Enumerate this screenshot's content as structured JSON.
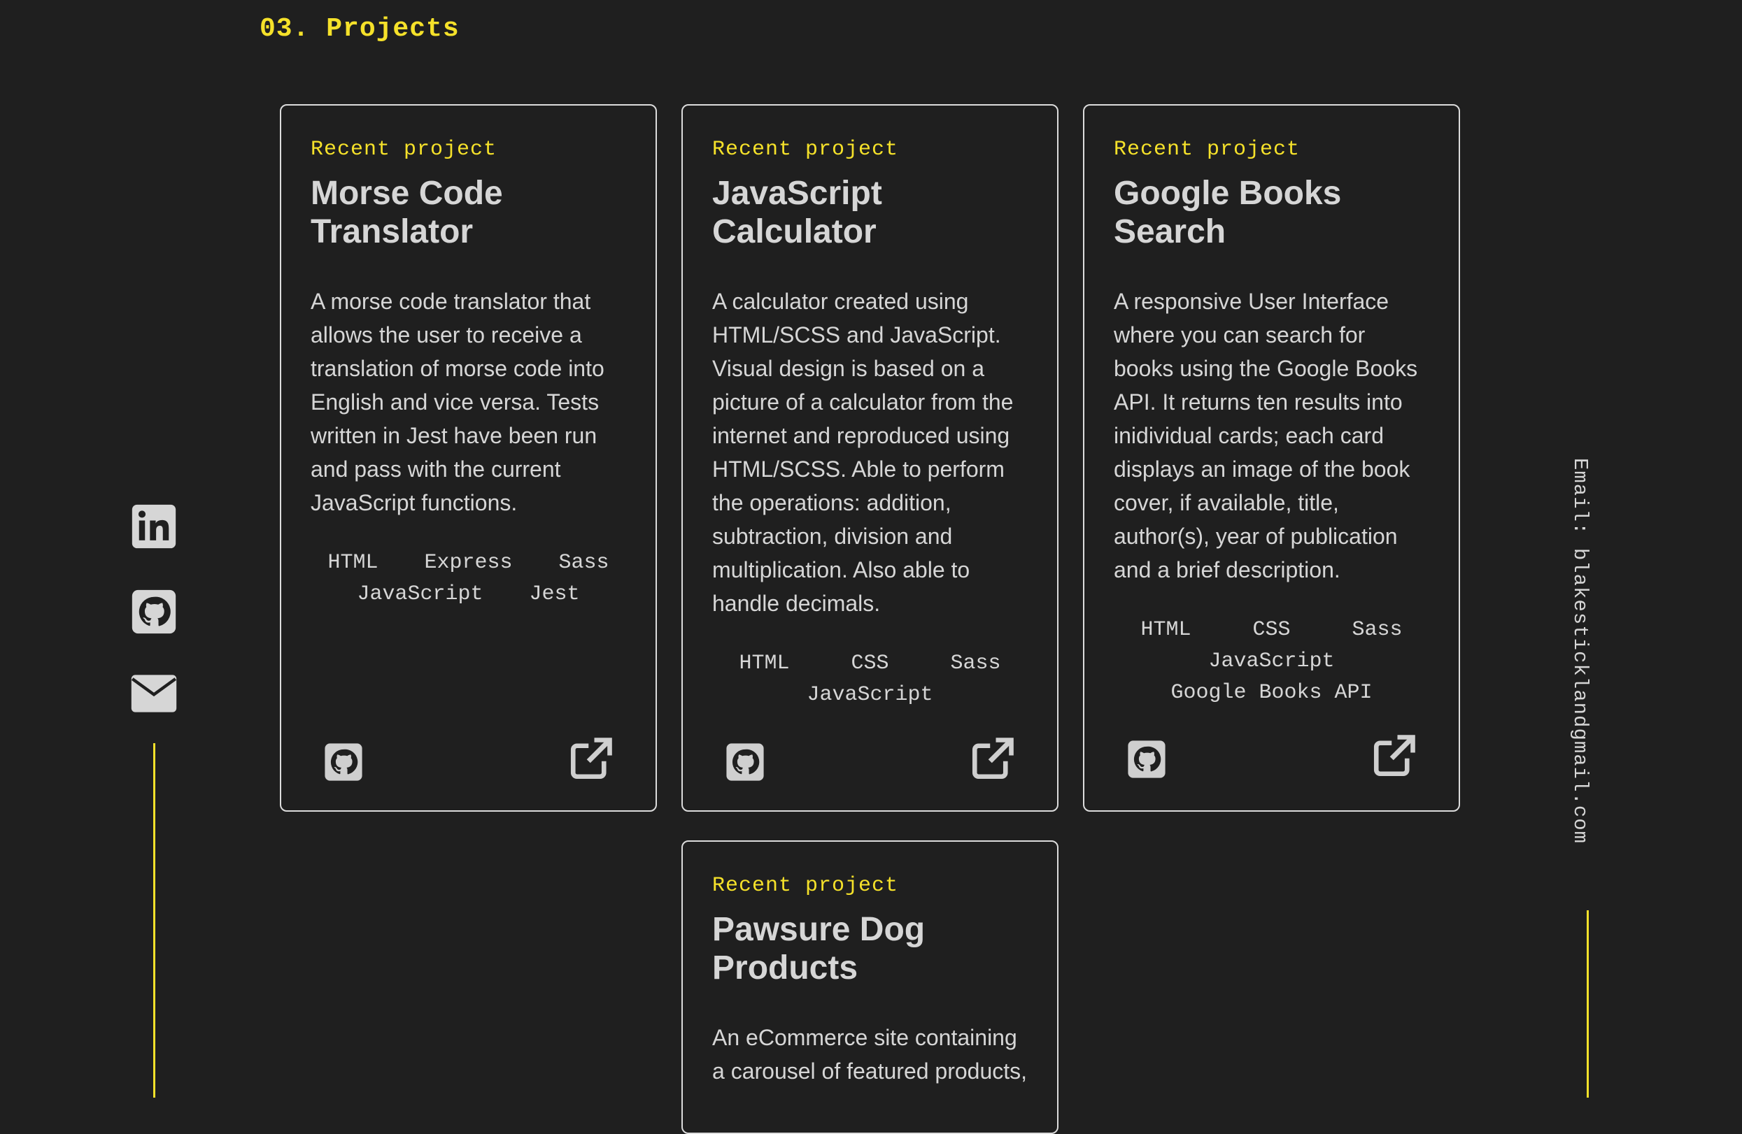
{
  "section": {
    "title": "03. Projects"
  },
  "social": {
    "icons": [
      "linkedin-icon",
      "github-icon",
      "mail-icon"
    ]
  },
  "email": {
    "text": "Email: blakesticklandgmail.com"
  },
  "colors": {
    "accent": "#f5e12a",
    "background": "#1f1f1f",
    "text": "#d6d6d6",
    "border": "#dcdcdc"
  },
  "projects": [
    {
      "kicker": "Recent project",
      "title": "Morse Code Translator",
      "description": "A morse code translator that allows the user to receive a translation of morse code into English and vice versa. Tests written in Jest have been run and pass with the current JavaScript functions.",
      "tech": [
        "HTML",
        "Express",
        "Sass",
        "JavaScript",
        "Jest"
      ]
    },
    {
      "kicker": "Recent project",
      "title": "JavaScript Calculator",
      "description": "A calculator created using HTML/SCSS and JavaScript. Visual design is based on a picture of a calculator from the internet and reproduced using HTML/SCSS. Able to perform the operations: addition, subtraction, division and multiplication. Also able to handle decimals.",
      "tech": [
        "HTML",
        "CSS",
        "Sass",
        "JavaScript"
      ]
    },
    {
      "kicker": "Recent project",
      "title": "Google Books Search",
      "description": "A responsive User Interface where you can search for books using the Google Books API. It returns ten results into inidividual cards; each card displays an image of the book cover, if available, title, author(s), year of publication and a brief description.",
      "tech": [
        "HTML",
        "CSS",
        "Sass",
        "JavaScript",
        "Google Books API"
      ]
    },
    {
      "kicker": "Recent project",
      "title": "Pawsure Dog Products",
      "description": "An eCommerce site containing a carousel of featured products,",
      "tech": []
    }
  ]
}
